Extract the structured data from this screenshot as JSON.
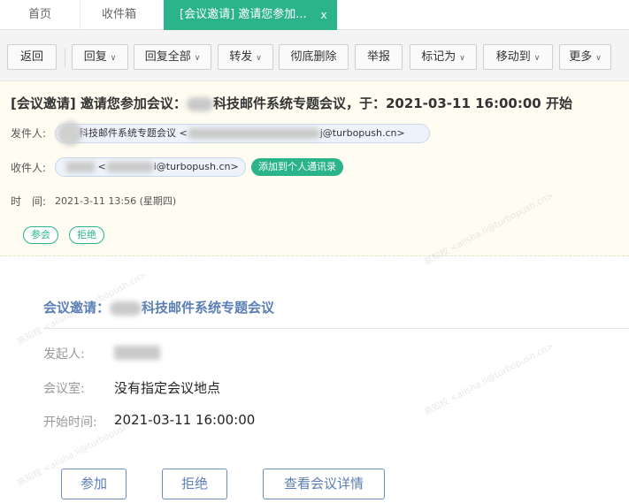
{
  "tabs": {
    "home": "首页",
    "inbox": "收件箱",
    "active": "[会议邀请] 邀请您参加...",
    "close": "x"
  },
  "toolbar": {
    "back": "返回",
    "reply": "回复",
    "reply_all": "回复全部",
    "forward": "转发",
    "delete_permanently": "彻底删除",
    "report": "举报",
    "mark_as": "标记为",
    "move_to": "移动到",
    "more": "更多",
    "caret": "∨"
  },
  "header": {
    "subject_prefix": "[会议邀请] 邀请您参加会议：",
    "subject_suffix": "科技邮件系统专题会议，于：2021-03-11 16:00:00 开始",
    "sender_label": "发件人:",
    "sender_name": "科技邮件系统专题会议 <",
    "sender_domain": "j@turbopush.cn>",
    "recipient_label": "收件人:",
    "recipient_lt": "<",
    "recipient_domain": "i@turbopush.cn>",
    "add_contact": "添加到个人通讯录",
    "time_label": "时　间:",
    "time_value": "2021-3-11 13:56 (星期四)",
    "accept": "参会",
    "decline": "拒绝"
  },
  "invitation": {
    "title_prefix": "会议邀请：",
    "title_suffix": "科技邮件系统专题会议",
    "organizer_label": "发起人:",
    "room_label": "会议室:",
    "room_value": "没有指定会议地点",
    "start_label": "开始时间:",
    "start_value": "2021-03-11 16:00:00",
    "btn_join": "参加",
    "btn_decline": "拒绝",
    "btn_details": "查看会议详情"
  },
  "watermark": {
    "line1": "高知校",
    "line2": "<aiisha.li@turbopush.cn>"
  },
  "colors": {
    "accent_green": "#2bb48a",
    "link_blue": "#5b7fb4",
    "header_bg": "#fffdf1"
  }
}
